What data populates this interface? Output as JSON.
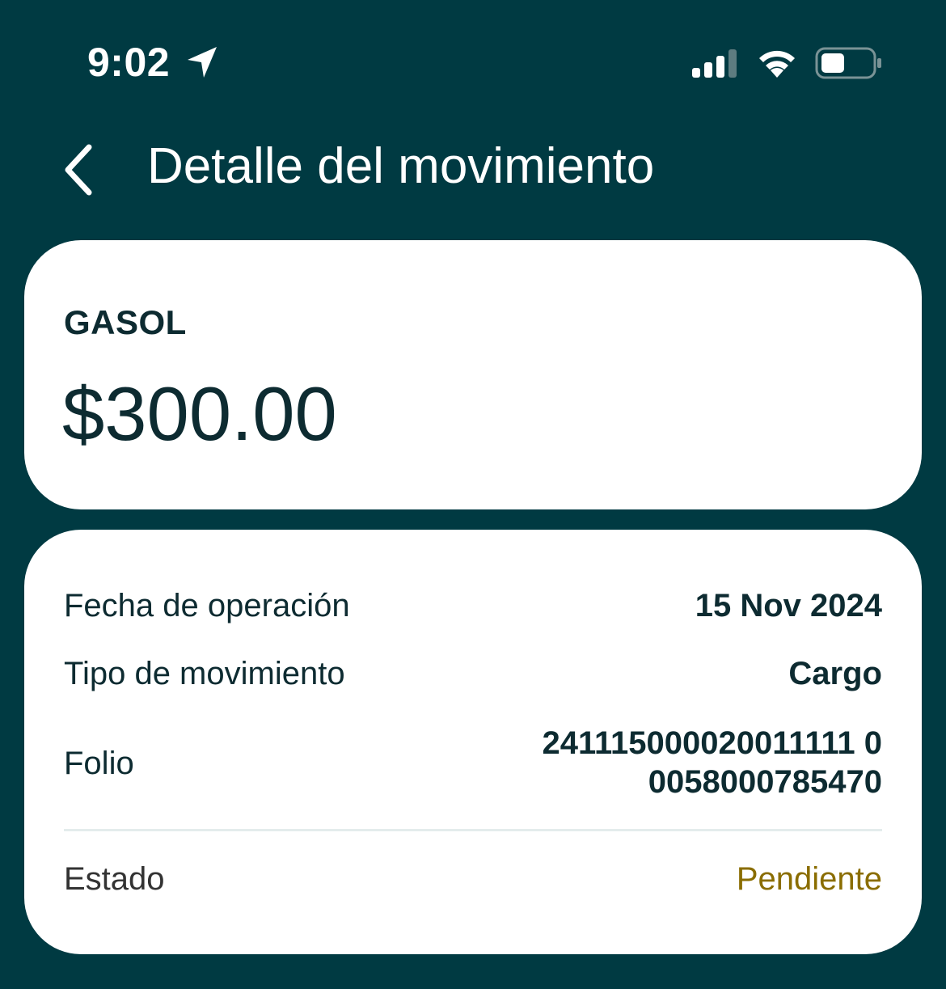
{
  "status_bar": {
    "time": "9:02",
    "icons": [
      "location-arrow-icon",
      "cellular-signal-icon",
      "wifi-icon",
      "battery-icon"
    ]
  },
  "header": {
    "back_icon": "chevron-left-icon",
    "title": "Detalle del movimiento"
  },
  "summary": {
    "merchant": "GASOL",
    "amount": "$300.00"
  },
  "details": {
    "date_label": "Fecha de operación",
    "date_value": "15 Nov 2024",
    "type_label": "Tipo de movimiento",
    "type_value": "Cargo",
    "folio_label": "Folio",
    "folio_line1": "241115000020011111 0",
    "folio_line2": "0058000785470",
    "status_label": "Estado",
    "status_value": "Pendiente"
  },
  "colors": {
    "background": "#003A42",
    "card": "#FFFFFF",
    "text_primary": "#0D2B31",
    "status_pending": "#8A6D00"
  }
}
